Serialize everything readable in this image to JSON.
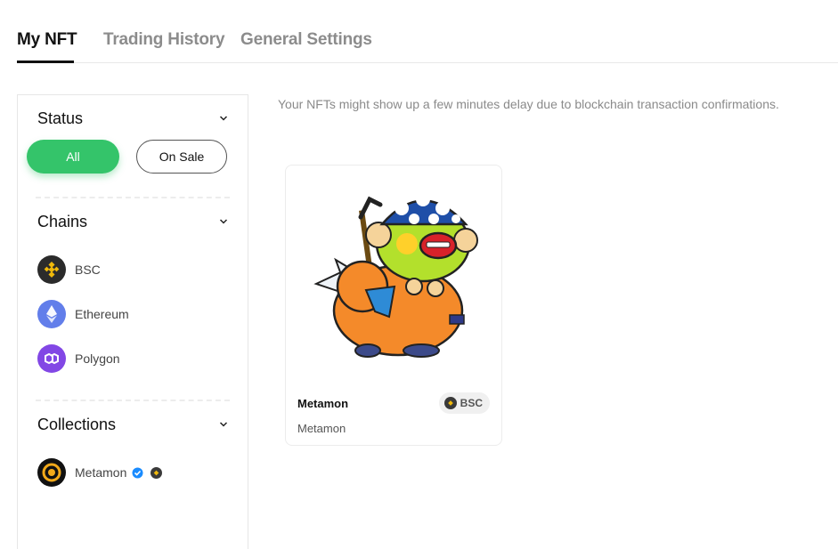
{
  "tabs": [
    {
      "label": "My NFT",
      "active": true
    },
    {
      "label": "Trading History",
      "active": false
    },
    {
      "label": "General Settings",
      "active": false
    }
  ],
  "sidebar": {
    "status": {
      "title": "Status",
      "options": [
        {
          "label": "All",
          "selected": true
        },
        {
          "label": "On Sale",
          "selected": false
        }
      ]
    },
    "chains": {
      "title": "Chains",
      "items": [
        {
          "label": "BSC",
          "icon": "bsc-icon",
          "color": "#f0b90b"
        },
        {
          "label": "Ethereum",
          "icon": "ethereum-icon",
          "color": "#627eea"
        },
        {
          "label": "Polygon",
          "icon": "polygon-icon",
          "color": "#8247e5"
        }
      ]
    },
    "collections": {
      "title": "Collections",
      "items": [
        {
          "label": "Metamon",
          "icon": "metamon-logo-icon",
          "verified": true,
          "chain_icon": "bsc-icon"
        }
      ]
    }
  },
  "notice": "Your NFTs might show up a few minutes delay due to blockchain transaction confirmations.",
  "cards": [
    {
      "name": "Metamon",
      "collection": "Metamon",
      "chain": "BSC",
      "image": "metamon-character-illustration"
    }
  ],
  "colors": {
    "accent": "#34c46a",
    "bsc": "#f0b90b",
    "ethereum": "#627eea",
    "polygon": "#8247e5",
    "verified": "#1a8cff"
  }
}
